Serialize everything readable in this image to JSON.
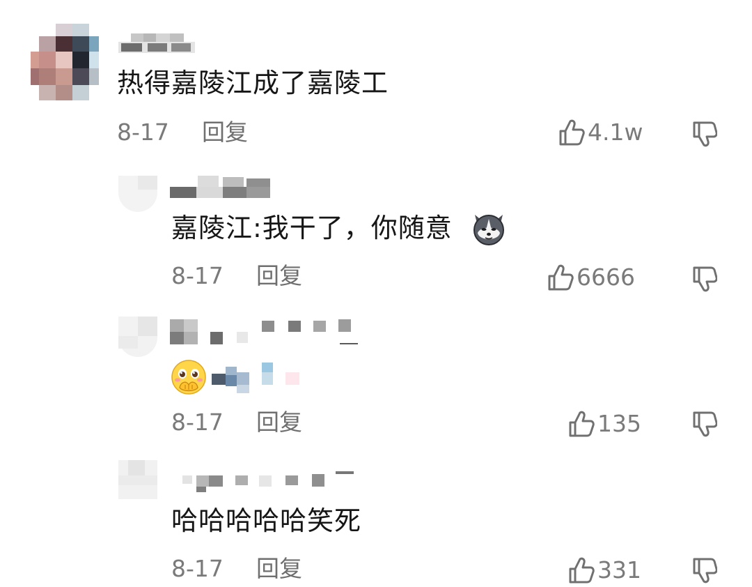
{
  "comments": [
    {
      "text": "热得嘉陵江成了嘉陵工",
      "date": "8-17",
      "reply_label": "回复",
      "likes": "4.1w"
    },
    {
      "text": "嘉陵江:我干了，你随意",
      "emoji": "husky-dog-emoji",
      "date": "8-17",
      "reply_label": "回复",
      "likes": "6666"
    },
    {
      "emoji": "shy-face-emoji",
      "date": "8-17",
      "reply_label": "回复",
      "likes": "135"
    },
    {
      "text": "哈哈哈哈哈笑死",
      "date": "8-17",
      "reply_label": "回复",
      "likes": "331"
    }
  ],
  "colors": {
    "meta": "#7a7a7a",
    "text": "#161616",
    "icon": "#707070"
  },
  "icons": [
    "thumbs-up-icon",
    "thumbs-down-icon"
  ]
}
